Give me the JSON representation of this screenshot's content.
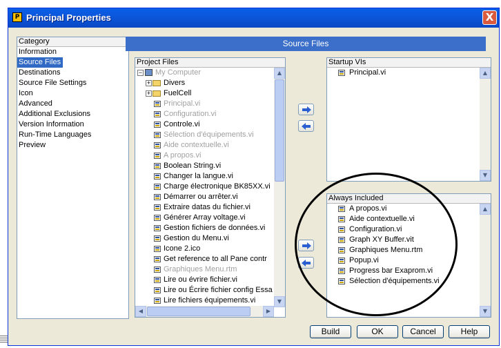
{
  "window": {
    "title": "Principal Properties",
    "close": "X"
  },
  "category": {
    "header": "Category",
    "items": [
      {
        "label": "Information"
      },
      {
        "label": "Source Files"
      },
      {
        "label": "Destinations"
      },
      {
        "label": "Source File Settings"
      },
      {
        "label": "Icon"
      },
      {
        "label": "Advanced"
      },
      {
        "label": "Additional Exclusions"
      },
      {
        "label": "Version Information"
      },
      {
        "label": "Run-Time Languages"
      },
      {
        "label": "Preview"
      }
    ],
    "selected": "Source Files"
  },
  "banner": "Source Files",
  "project_files": {
    "header": "Project Files",
    "items": [
      {
        "label": "My Computer",
        "icon": "computer-icon",
        "greyed": true
      },
      {
        "label": "Divers",
        "icon": "folder-icon",
        "greyed": false
      },
      {
        "label": "FuelCell",
        "icon": "folder-icon",
        "greyed": false
      },
      {
        "label": "Principal.vi",
        "icon": "vi-file-icon",
        "greyed": true
      },
      {
        "label": "Configuration.vi",
        "icon": "vi-file-icon",
        "greyed": true
      },
      {
        "label": "Controle.vi",
        "icon": "vi-file-icon",
        "greyed": false
      },
      {
        "label": "Sélection d'équipements.vi",
        "icon": "vi-file-icon",
        "greyed": true
      },
      {
        "label": "Aide contextuelle.vi",
        "icon": "vi-file-icon",
        "greyed": true
      },
      {
        "label": "A propos.vi",
        "icon": "vi-file-icon",
        "greyed": true
      },
      {
        "label": "Boolean String.vi",
        "icon": "vi-file-icon",
        "greyed": false
      },
      {
        "label": "Changer la langue.vi",
        "icon": "vi-file-icon",
        "greyed": false
      },
      {
        "label": "Charge électronique BK85XX.vi",
        "icon": "vi-file-icon",
        "greyed": false
      },
      {
        "label": "Démarrer ou arrêter.vi",
        "icon": "vi-file-icon",
        "greyed": false
      },
      {
        "label": "Extraire datas du fichier.vi",
        "icon": "vi-file-icon",
        "greyed": false
      },
      {
        "label": "Générer Array voltage.vi",
        "icon": "vi-file-icon",
        "greyed": false
      },
      {
        "label": "Gestion fichiers de données.vi",
        "icon": "vi-file-icon",
        "greyed": false
      },
      {
        "label": "Gestion du Menu.vi",
        "icon": "vi-file-icon",
        "greyed": false
      },
      {
        "label": "Icone 2.ico",
        "icon": "ico-file-icon",
        "greyed": false
      },
      {
        "label": "Get reference to all Pane contr",
        "icon": "vi-file-icon",
        "greyed": false
      },
      {
        "label": "Graphiques Menu.rtm",
        "icon": "vi-file-icon",
        "greyed": true
      },
      {
        "label": "Lire ou évrire fichier.vi",
        "icon": "vi-file-icon",
        "greyed": false
      },
      {
        "label": "Lire ou Écrire fichier config Essa",
        "icon": "vi-file-icon",
        "greyed": false
      },
      {
        "label": "Lire fichiers équipements.vi",
        "icon": "vi-file-icon",
        "greyed": false
      }
    ]
  },
  "startup_vis": {
    "header": "Startup VIs",
    "items": [
      {
        "label": "Principal.vi"
      }
    ]
  },
  "always_included": {
    "header": "Always Included",
    "items": [
      {
        "label": "A propos.vi"
      },
      {
        "label": "Aide contextuelle.vi"
      },
      {
        "label": "Configuration.vi"
      },
      {
        "label": "Graph XY Buffer.vit"
      },
      {
        "label": "Graphiques Menu.rtm"
      },
      {
        "label": "Popup.vi"
      },
      {
        "label": "Progress bar  Exaprom.vi"
      },
      {
        "label": "Sélection d'équipements.vi"
      }
    ]
  },
  "buttons": {
    "build": "Build",
    "ok": "OK",
    "cancel": "Cancel",
    "help": "Help"
  },
  "colors": {
    "title_bar": "#0b55d8",
    "banner": "#3b6fc9",
    "selection": "#316ac5",
    "greyed_text": "#a0a0a0"
  }
}
